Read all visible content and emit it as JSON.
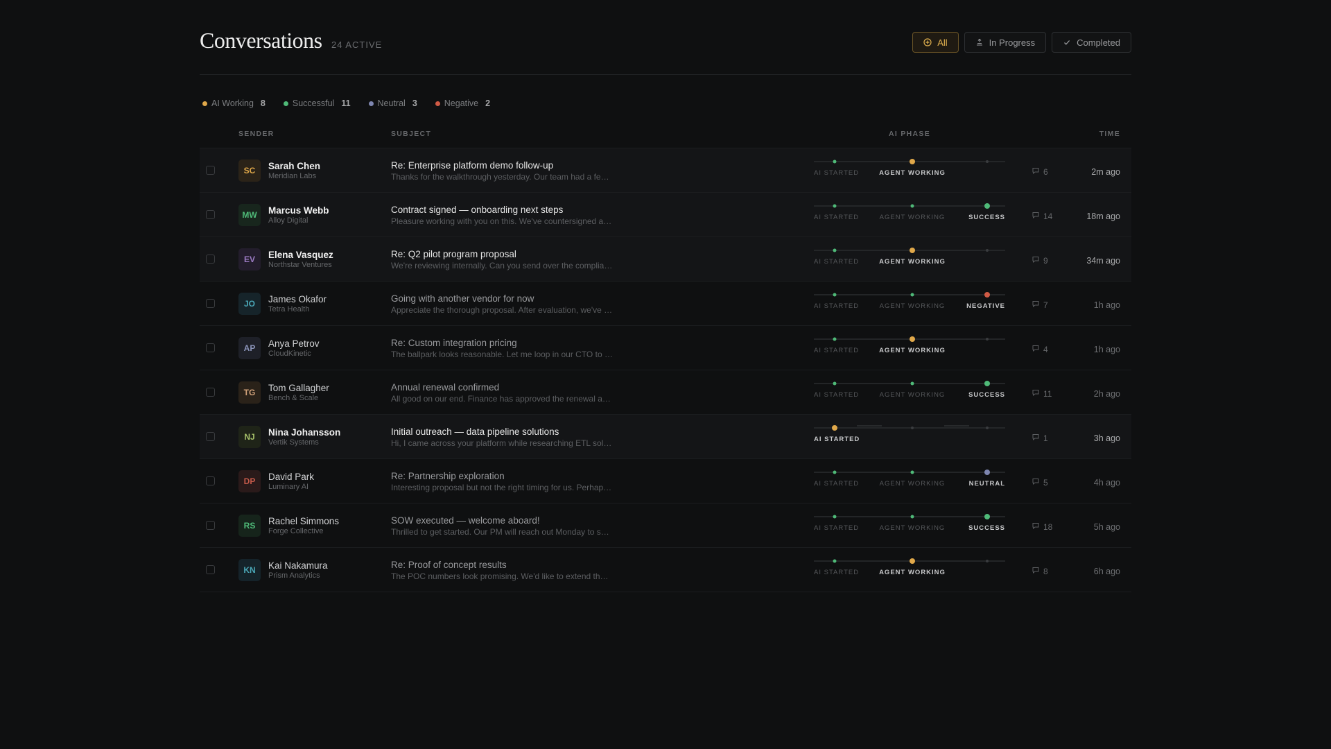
{
  "header": {
    "title": "Conversations",
    "active_count": "24 ACTIVE"
  },
  "filters": [
    {
      "label": "All",
      "icon": "plus-circle-icon",
      "active": true
    },
    {
      "label": "In Progress",
      "icon": "stack-icon",
      "active": false
    },
    {
      "label": "Completed",
      "icon": "check-icon",
      "active": false
    }
  ],
  "legend": [
    {
      "label": "AI Working",
      "count": "8",
      "color": "#e0a84a"
    },
    {
      "label": "Successful",
      "count": "11",
      "color": "#4fba78"
    },
    {
      "label": "Neutral",
      "count": "3",
      "color": "#7e86b0"
    },
    {
      "label": "Negative",
      "count": "2",
      "color": "#d05a45"
    }
  ],
  "columns": {
    "sender": "SENDER",
    "subject": "SUBJECT",
    "phase": "AI PHASE",
    "time": "TIME"
  },
  "phase_labels": {
    "started": "AI STARTED",
    "working": "AGENT WORKING",
    "success": "SUCCESS",
    "negative": "NEGATIVE",
    "neutral": "NEUTRAL"
  },
  "colors": {
    "working": "#e0a84a",
    "success": "#4fba78",
    "neutral": "#7e86b0",
    "negative": "#d05a45"
  },
  "rows": [
    {
      "initials": "SC",
      "name": "Sarah Chen",
      "company": "Meridian Labs",
      "subject": "Re: Enterprise platform demo follow-up",
      "preview": "Thanks for the walkthrough yesterday. Our team had a fe…",
      "phase": "working",
      "messages": "6",
      "time": "2m ago",
      "unread": true,
      "avatar_color": "#e0a84a",
      "avatar_bg": "#2b2318"
    },
    {
      "initials": "MW",
      "name": "Marcus Webb",
      "company": "Alloy Digital",
      "subject": "Contract signed — onboarding next steps",
      "preview": "Pleasure working with you on this. We've countersigned a…",
      "phase": "success",
      "messages": "14",
      "time": "18m ago",
      "unread": true,
      "avatar_color": "#4fba78",
      "avatar_bg": "#18261d"
    },
    {
      "initials": "EV",
      "name": "Elena Vasquez",
      "company": "Northstar Ventures",
      "subject": "Re: Q2 pilot program proposal",
      "preview": "We're reviewing internally. Can you send over the complia…",
      "phase": "working",
      "messages": "9",
      "time": "34m ago",
      "unread": true,
      "avatar_color": "#9c7cc4",
      "avatar_bg": "#231d2c"
    },
    {
      "initials": "JO",
      "name": "James Okafor",
      "company": "Tetra Health",
      "subject": "Going with another vendor for now",
      "preview": "Appreciate the thorough proposal. After evaluation, we've …",
      "phase": "negative",
      "messages": "7",
      "time": "1h ago",
      "unread": false,
      "avatar_color": "#4aa6b6",
      "avatar_bg": "#16242a"
    },
    {
      "initials": "AP",
      "name": "Anya Petrov",
      "company": "CloudKinetic",
      "subject": "Re: Custom integration pricing",
      "preview": "The ballpark looks reasonable. Let me loop in our CTO to …",
      "phase": "working",
      "messages": "4",
      "time": "1h ago",
      "unread": false,
      "avatar_color": "#8a93b8",
      "avatar_bg": "#1e2028"
    },
    {
      "initials": "TG",
      "name": "Tom Gallagher",
      "company": "Bench & Scale",
      "subject": "Annual renewal confirmed",
      "preview": "All good on our end. Finance has approved the renewal a…",
      "phase": "success",
      "messages": "11",
      "time": "2h ago",
      "unread": false,
      "avatar_color": "#d1a27a",
      "avatar_bg": "#2a2219"
    },
    {
      "initials": "NJ",
      "name": "Nina Johansson",
      "company": "Vertik Systems",
      "subject": "Initial outreach — data pipeline solutions",
      "preview": "Hi, I came across your platform while researching ETL sol…",
      "phase": "started",
      "messages": "1",
      "time": "3h ago",
      "unread": true,
      "avatar_color": "#a7c26a",
      "avatar_bg": "#1f2418"
    },
    {
      "initials": "DP",
      "name": "David Park",
      "company": "Luminary AI",
      "subject": "Re: Partnership exploration",
      "preview": "Interesting proposal but not the right timing for us. Perhap…",
      "phase": "neutral",
      "messages": "5",
      "time": "4h ago",
      "unread": false,
      "avatar_color": "#c45a4a",
      "avatar_bg": "#2a1a1a"
    },
    {
      "initials": "RS",
      "name": "Rachel Simmons",
      "company": "Forge Collective",
      "subject": "SOW executed — welcome aboard!",
      "preview": "Thrilled to get started. Our PM will reach out Monday to s…",
      "phase": "success",
      "messages": "18",
      "time": "5h ago",
      "unread": false,
      "avatar_color": "#4fba78",
      "avatar_bg": "#16241b"
    },
    {
      "initials": "KN",
      "name": "Kai Nakamura",
      "company": "Prism Analytics",
      "subject": "Re: Proof of concept results",
      "preview": "The POC numbers look promising. We'd like to extend th…",
      "phase": "working",
      "messages": "8",
      "time": "6h ago",
      "unread": false,
      "avatar_color": "#4aa6b6",
      "avatar_bg": "#15232a"
    }
  ]
}
